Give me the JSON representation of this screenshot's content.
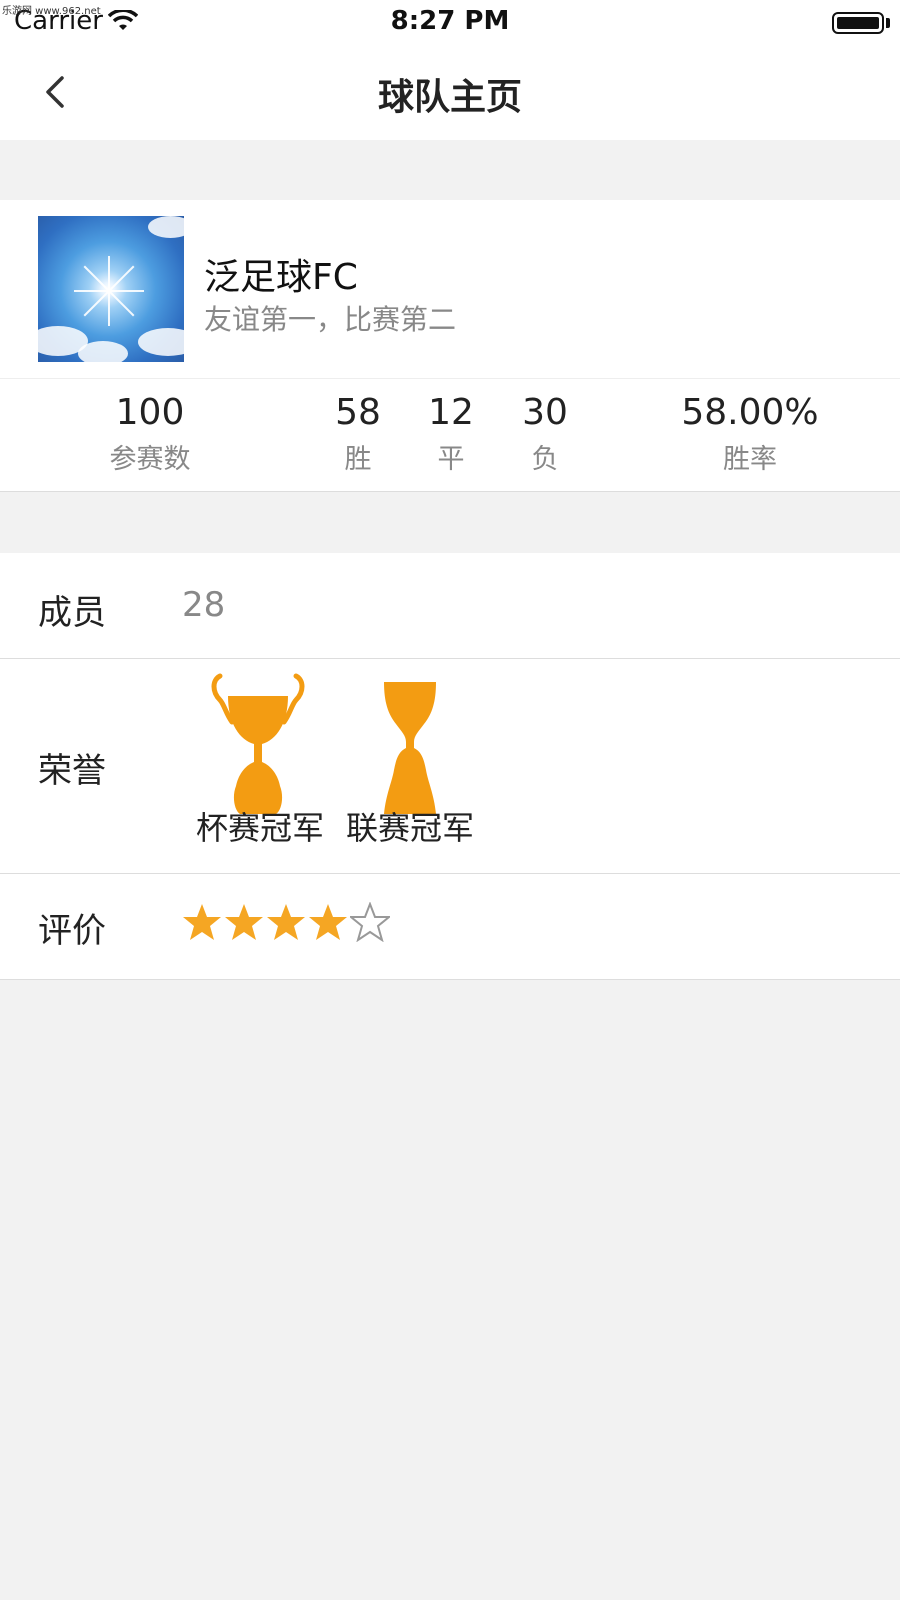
{
  "watermark": "乐游网 www.962.net",
  "status_bar": {
    "carrier": "Carrier",
    "time": "8:27 PM"
  },
  "nav": {
    "title": "球队主页",
    "back_icon": "chevron-left-icon"
  },
  "team": {
    "name": "泛足球FC",
    "motto": "友谊第一，比赛第二",
    "stats": [
      {
        "value": "100",
        "label": "参赛数"
      },
      {
        "value": "58",
        "label": "胜"
      },
      {
        "value": "12",
        "label": "平"
      },
      {
        "value": "30",
        "label": "负"
      },
      {
        "value": "58.00%",
        "label": "胜率"
      }
    ]
  },
  "details": {
    "members_label": "成员",
    "members_value": "28",
    "honors_label": "荣誉",
    "honors": [
      {
        "label": "杯赛冠军",
        "icon": "cup-trophy-icon"
      },
      {
        "label": "联赛冠军",
        "icon": "league-trophy-icon"
      }
    ],
    "rating_label": "评价",
    "rating": {
      "value": 4,
      "max": 5
    }
  },
  "colors": {
    "trophy": "#f39c12",
    "star": "#f5a623",
    "accent_text": "#888888"
  }
}
